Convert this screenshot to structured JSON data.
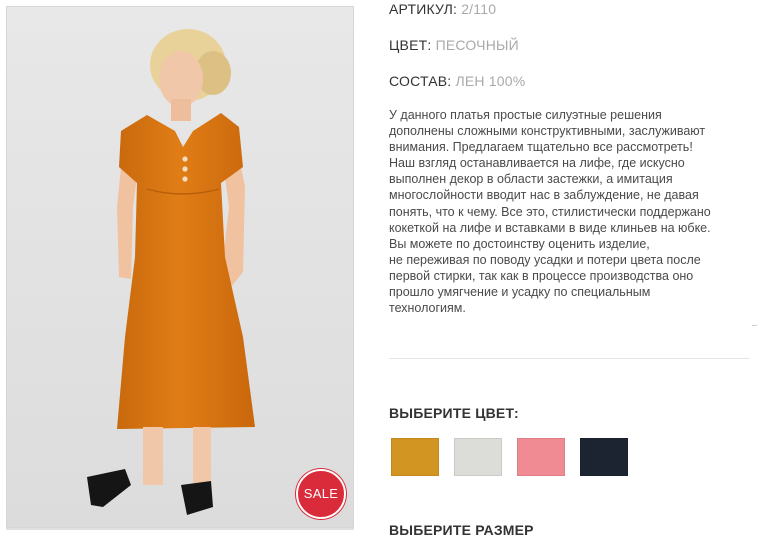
{
  "product": {
    "image_alt": "dress-photo",
    "sale_badge": "SALE",
    "attributes": {
      "article_label": "АРТИКУЛ:",
      "article_value": "2/110",
      "color_label": "ЦВЕТ:",
      "color_value": "ПЕСОЧНЫЙ",
      "composition_label": "СОСТАВ:",
      "composition_value": "ЛЕН 100%"
    },
    "description_lines": [
      "У данного платья простые силуэтные решения",
      "дополнены сложными конструктивными, заслуживают",
      "внимания. Предлагаем тщательно все рассмотреть!",
      "Наш взгляд останавливается на лифе, где искусно",
      "выполнен декор в области застежки, а имитация",
      "многослойности вводит нас в заблуждение, не давая",
      "понять, что к чему. Все это, стилистически поддержано",
      "кокеткой на лифе и вставками в виде клиньев на юбке.",
      "Вы можете по достоинству оценить изделие,",
      "не переживая по поводу усадки и потери цвета после",
      "первой стирки, так как в процессе производства оно",
      "прошло умягчение и усадку по специальным",
      "технологиям."
    ]
  },
  "color_picker": {
    "title": "ВЫБЕРИТЕ ЦВЕТ:",
    "swatches": [
      {
        "name": "mustard",
        "color": "#d29521"
      },
      {
        "name": "light-gray",
        "color": "#dcdcd8"
      },
      {
        "name": "pink",
        "color": "#f08a93"
      },
      {
        "name": "navy",
        "color": "#1c2431"
      }
    ]
  },
  "size_picker": {
    "title": "ВЫБЕРИТЕ РАЗМЕР"
  }
}
